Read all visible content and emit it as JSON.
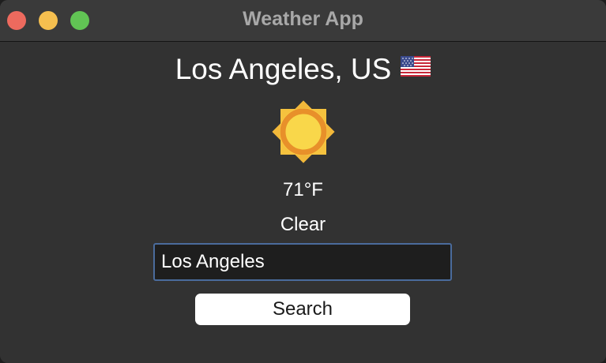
{
  "window": {
    "title": "Weather App",
    "buttons": [
      "close",
      "minimize",
      "maximize"
    ]
  },
  "weather": {
    "city": "Los Angeles, US",
    "flag_icon": "us-flag-icon",
    "condition_icon": "sun-icon",
    "temperature": "71°F",
    "condition": "Clear"
  },
  "search": {
    "input_value": "Los Angeles",
    "button_label": "Search"
  },
  "colors": {
    "background": "#323232",
    "titlebar": "#3a3a3a",
    "close": "#ed6a5e",
    "minimize": "#f5bf4f",
    "maximize": "#61c454",
    "input_border": "#4a6b9c",
    "sun_fill": "#f9d74a",
    "sun_ring": "#e8902a"
  }
}
